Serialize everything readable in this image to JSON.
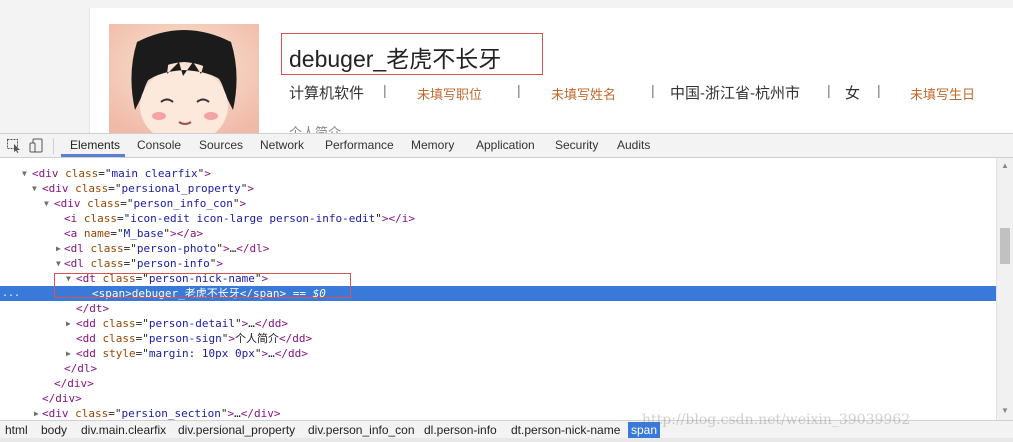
{
  "profile": {
    "nick": "debuger_老虎不长牙",
    "details": [
      "计算机软件",
      "|",
      "未填写职位",
      "|",
      "未填写姓名",
      "|",
      "中国-浙江省-杭州市",
      "|",
      "女",
      "|",
      "未填写生日"
    ],
    "sign_peek": "个人简介"
  },
  "devtools": {
    "tabs": [
      "Elements",
      "Console",
      "Sources",
      "Network",
      "Performance",
      "Memory",
      "Application",
      "Security",
      "Audits"
    ],
    "active_tab": "Elements",
    "tree": [
      {
        "arrow": "▼",
        "code": [
          [
            "t",
            "<div "
          ],
          [
            "a",
            "class"
          ],
          [
            "x",
            "=\""
          ],
          [
            "v",
            "main clearfix"
          ],
          [
            "x",
            "\""
          ],
          [
            "t",
            ">"
          ]
        ]
      },
      {
        "arrow": "▼",
        "code": [
          [
            "t",
            "<div "
          ],
          [
            "a",
            "class"
          ],
          [
            "x",
            "=\""
          ],
          [
            "v",
            "persional_property"
          ],
          [
            "x",
            "\""
          ],
          [
            "t",
            ">"
          ]
        ]
      },
      {
        "arrow": "▼",
        "code": [
          [
            "t",
            "<div "
          ],
          [
            "a",
            "class"
          ],
          [
            "x",
            "=\""
          ],
          [
            "v",
            "person_info_con"
          ],
          [
            "x",
            "\""
          ],
          [
            "t",
            ">"
          ]
        ]
      },
      {
        "arrow": "",
        "code": [
          [
            "t",
            "<i "
          ],
          [
            "a",
            "class"
          ],
          [
            "x",
            "=\""
          ],
          [
            "v",
            "icon-edit icon-large person-info-edit"
          ],
          [
            "x",
            "\""
          ],
          [
            "t",
            "></i>"
          ]
        ]
      },
      {
        "arrow": "",
        "code": [
          [
            "t",
            "<a "
          ],
          [
            "a",
            "name"
          ],
          [
            "x",
            "=\""
          ],
          [
            "v",
            "M_base"
          ],
          [
            "x",
            "\""
          ],
          [
            "t",
            "></a>"
          ]
        ]
      },
      {
        "arrow": "▶",
        "code": [
          [
            "t",
            "<dl "
          ],
          [
            "a",
            "class"
          ],
          [
            "x",
            "=\""
          ],
          [
            "v",
            "person-photo"
          ],
          [
            "x",
            "\""
          ],
          [
            "t",
            ">"
          ],
          [
            "x",
            "…"
          ],
          [
            "t",
            "</dl>"
          ]
        ]
      },
      {
        "arrow": "▼",
        "code": [
          [
            "t",
            "<dl "
          ],
          [
            "a",
            "class"
          ],
          [
            "x",
            "=\""
          ],
          [
            "v",
            "person-info"
          ],
          [
            "x",
            "\""
          ],
          [
            "t",
            ">"
          ]
        ]
      },
      {
        "arrow": "▼",
        "code": [
          [
            "t",
            "<dt "
          ],
          [
            "a",
            "class"
          ],
          [
            "x",
            "=\""
          ],
          [
            "v",
            "person-nick-name"
          ],
          [
            "x",
            "\""
          ],
          [
            "t",
            ">"
          ]
        ]
      },
      {
        "arrow": "",
        "code": [
          [
            "t",
            "<span>"
          ],
          [
            "x",
            "debuger_老虎不长牙"
          ],
          [
            "t",
            "</span>"
          ],
          [
            "x",
            " == "
          ],
          [
            "x",
            "$0"
          ]
        ]
      },
      {
        "arrow": "",
        "code": [
          [
            "t",
            "</dt>"
          ]
        ]
      },
      {
        "arrow": "▶",
        "code": [
          [
            "t",
            "<dd "
          ],
          [
            "a",
            "class"
          ],
          [
            "x",
            "=\""
          ],
          [
            "v",
            "person-detail"
          ],
          [
            "x",
            "\""
          ],
          [
            "t",
            ">"
          ],
          [
            "x",
            "…"
          ],
          [
            "t",
            "</dd>"
          ]
        ]
      },
      {
        "arrow": "",
        "code": [
          [
            "t",
            "<dd "
          ],
          [
            "a",
            "class"
          ],
          [
            "x",
            "=\""
          ],
          [
            "v",
            "person-sign"
          ],
          [
            "x",
            "\""
          ],
          [
            "t",
            ">"
          ],
          [
            "x",
            "个人简介"
          ],
          [
            "t",
            "</dd>"
          ]
        ]
      },
      {
        "arrow": "▶",
        "code": [
          [
            "t",
            "<dd "
          ],
          [
            "a",
            "style"
          ],
          [
            "x",
            "=\""
          ],
          [
            "v",
            "margin: 10px 0px"
          ],
          [
            "x",
            "\""
          ],
          [
            "t",
            ">"
          ],
          [
            "x",
            "…"
          ],
          [
            "t",
            "</dd>"
          ]
        ]
      },
      {
        "arrow": "",
        "code": [
          [
            "t",
            "</dl>"
          ]
        ]
      },
      {
        "arrow": "",
        "code": [
          [
            "t",
            "</div>"
          ]
        ]
      },
      {
        "arrow": "",
        "code": [
          [
            "t",
            "</div>"
          ]
        ]
      },
      {
        "arrow": "▶",
        "code": [
          [
            "t",
            "<div "
          ],
          [
            "a",
            "class"
          ],
          [
            "x",
            "=\""
          ],
          [
            "v",
            "persion_section"
          ],
          [
            "x",
            "\""
          ],
          [
            "t",
            ">"
          ],
          [
            "x",
            "…"
          ],
          [
            "t",
            "</div>"
          ]
        ]
      }
    ],
    "selected_dots": "...",
    "breadcrumbs": [
      "html",
      "body",
      "div.main.clearfix",
      "div.persional_property",
      "div.person_info_con",
      "dl.person-info",
      "dt.person-nick-name",
      "span"
    ],
    "active_crumb": "span"
  },
  "watermark": "http://blog.csdn.net/weixin_39039962",
  "colors": {
    "accent": "#3879d9",
    "highlight_box": "#d9534f",
    "warn_text": "#c0692d"
  }
}
